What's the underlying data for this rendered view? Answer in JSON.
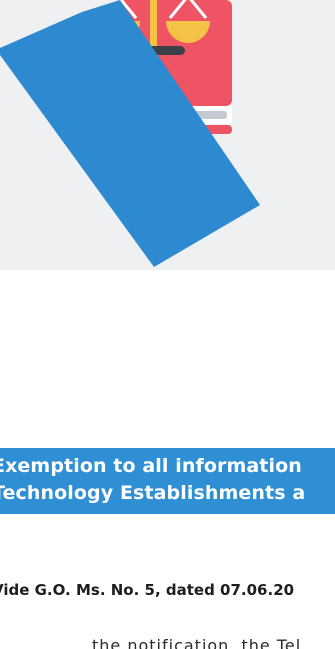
{
  "banner": {
    "line1": "Exemption to all information",
    "line2": "Technology Establishments a"
  },
  "go_reference": "Vide G.O. Ms. No. 5, dated 07.06.20",
  "body_snippet": "the notification, the Tel",
  "colors": {
    "banner": "#2f8fd4",
    "hero_background": "#eef0f2",
    "chevron": "#2e8ad0",
    "book": "#ee5464",
    "book_spine": "#5a5f68",
    "scale": "#f5c248",
    "scale_base": "#3b4049"
  },
  "icons": {
    "hero": "law-book-scale-icon"
  }
}
